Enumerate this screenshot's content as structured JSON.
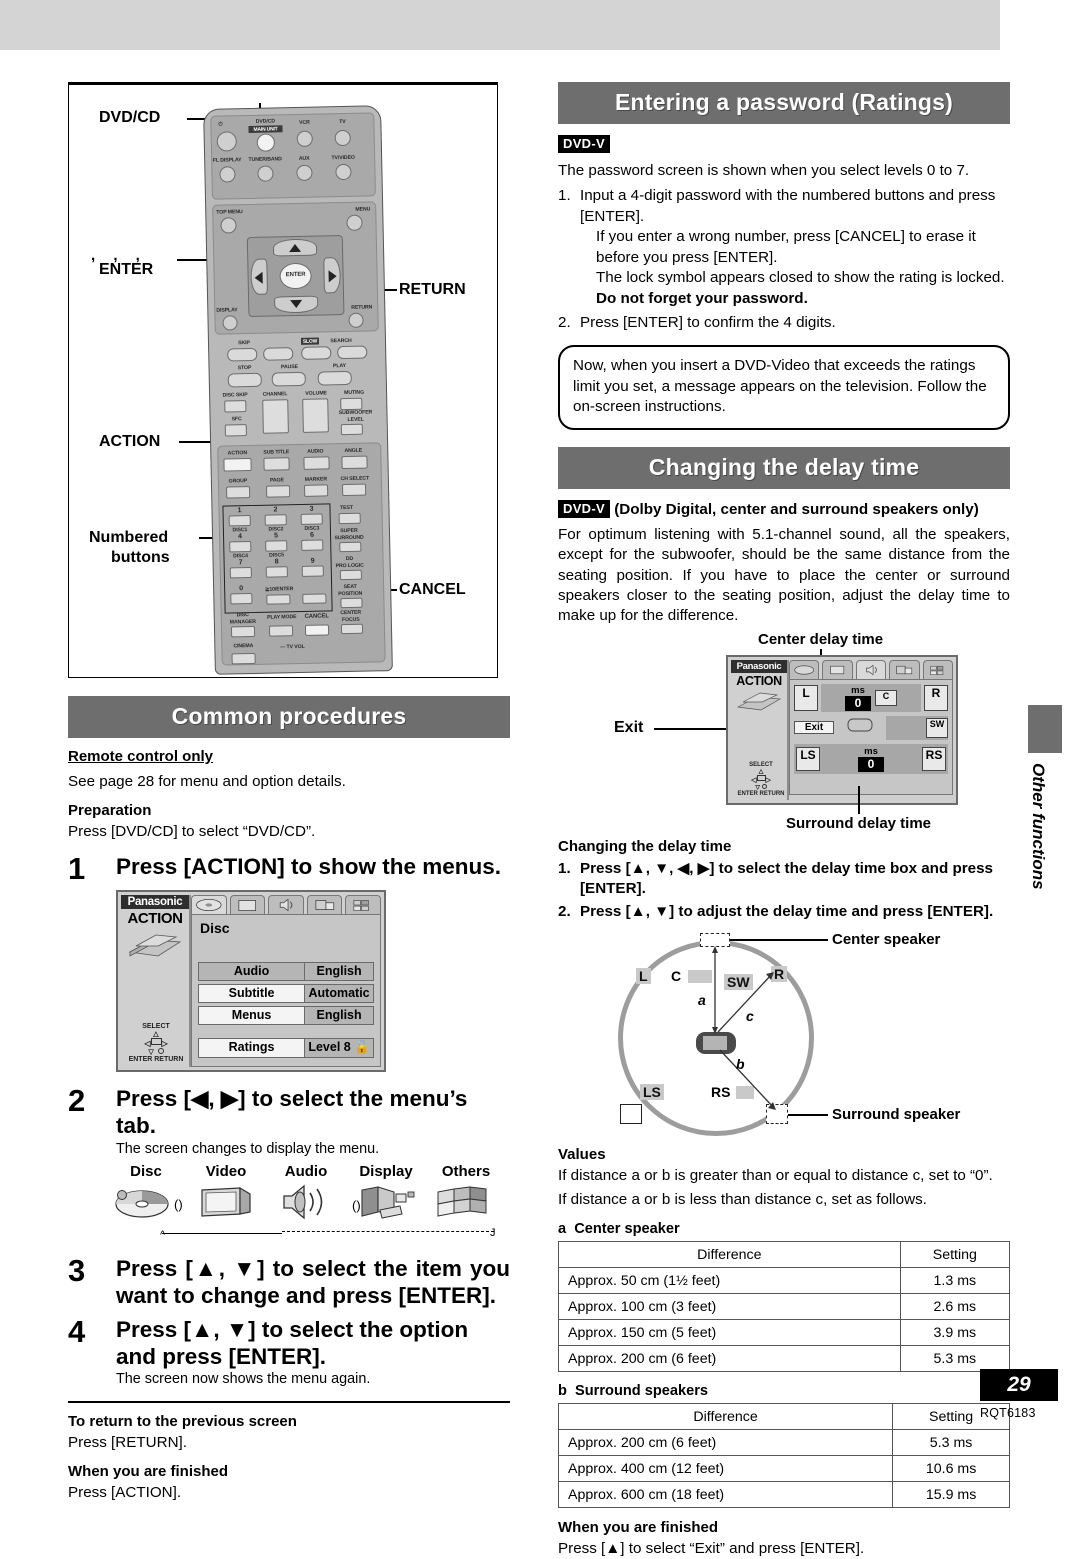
{
  "page": {
    "number": "29",
    "doc_code": "RQT6183"
  },
  "side_tab": {
    "label": "Other functions"
  },
  "remote_figure": {
    "callouts": {
      "dvd_cd": "DVD/CD",
      "arrows_enter": "ENTER",
      "return": "RETURN",
      "action": "ACTION",
      "numbered_buttons_l1": "Numbered",
      "numbered_buttons_l2": "buttons",
      "cancel": "CANCEL"
    },
    "buttons": {
      "power": "⏻",
      "dvd_cd": "DVD/CD",
      "main_unit": "MAIN UNIT",
      "vcr": "VCR",
      "tv": "TV",
      "fl_display": "FL DISPLAY",
      "tuner_band": "TUNER/BAND",
      "aux": "AUX",
      "tv_video": "TV/VIDEO",
      "top_menu": "TOP MENU",
      "menu": "MENU",
      "enter": "ENTER",
      "display": "DISPLAY",
      "return": "RETURN",
      "skip": "SKIP",
      "slow": "SLOW",
      "search": "SEARCH",
      "stop": "STOP",
      "pause": "PAUSE",
      "play": "PLAY",
      "disc_skip": "DISC SKIP",
      "channel": "CHANNEL",
      "volume": "VOLUME",
      "muting": "MUTING",
      "sfc": "SFC",
      "subwoofer": "SUBWOOFER",
      "level": "LEVEL",
      "action": "ACTION",
      "subtitle": "SUB TITLE",
      "audio": "AUDIO",
      "angle": "ANGLE",
      "group": "GROUP",
      "page": "PAGE",
      "marker": "MARKER",
      "ch_select": "CH SELECT",
      "test": "TEST",
      "super": "SUPER",
      "surround": "SURROUND",
      "dd": "DD",
      "pro_logic": "PRO LOGIC",
      "seat": "SEAT",
      "position": "POSITION",
      "n1": "1",
      "n2": "2",
      "n3": "3",
      "n4": "4",
      "n5": "5",
      "n6": "6",
      "n7": "7",
      "n8": "8",
      "n9": "9",
      "n0": "0",
      "disc1": "DISC1",
      "disc2": "DISC2",
      "disc3": "DISC3",
      "disc4": "DISC4",
      "disc5": "DISC5",
      "ten_enter": "≧10/ENTER",
      "disc_manager_l1": "DISC",
      "disc_manager_l2": "MANAGER",
      "play_mode": "PLAY MODE",
      "cancel": "CANCEL",
      "center_l1": "CENTER",
      "center_l2": "FOCUS",
      "cinema": "CINEMA",
      "tv_vol": "— TV VOL"
    }
  },
  "common_procedures": {
    "heading": "Common procedures",
    "remote_only": "Remote control only",
    "see_page": "See page 28 for menu and option details.",
    "preparation_label": "Preparation",
    "preparation_text": "Press [DVD/CD] to select “DVD/CD”.",
    "steps": [
      {
        "num": "1",
        "text": "Press [ACTION] to show the menus.",
        "sub": ""
      },
      {
        "num": "2",
        "text": "Press [◀, ▶] to select the menu’s tab.",
        "sub": "The screen changes to display the menu."
      },
      {
        "num": "3",
        "text": "Press [▲, ▼] to select the item you want to change and press [ENTER].",
        "sub": ""
      },
      {
        "num": "4",
        "text": "Press [▲, ▼] to select the option and press [ENTER].",
        "sub": "The screen now shows the menu again."
      }
    ],
    "tab_icons": [
      {
        "label": "Disc",
        "icon": "disc-icon"
      },
      {
        "label": "Video",
        "icon": "television-icon"
      },
      {
        "label": "Audio",
        "icon": "speaker-icon"
      },
      {
        "label": "Display",
        "icon": "display-panels-icon"
      },
      {
        "label": "Others",
        "icon": "grid-panels-icon"
      }
    ],
    "footer": [
      {
        "title": "To return to the previous screen",
        "body": "Press [RETURN]."
      },
      {
        "title": "When you are finished",
        "body": "Press [ACTION]."
      }
    ]
  },
  "disc_menu_osd": {
    "brand": "Panasonic",
    "action": "ACTION",
    "title": "Disc",
    "select_label": "SELECT",
    "enter_label": "ENTER",
    "return_label": "RETURN",
    "rows": [
      {
        "name": "Audio",
        "value": "English",
        "highlight": false
      },
      {
        "name": "Subtitle",
        "value": "Automatic",
        "highlight": true
      },
      {
        "name": "Menus",
        "value": "English",
        "highlight": true
      }
    ],
    "ratings_row": {
      "name": "Ratings",
      "value": "Level 8",
      "lock_icon": "lock-icon"
    }
  },
  "password_section": {
    "heading": "Entering a password (Ratings)",
    "chip": "DVD-V",
    "intro": "The password screen is shown when you select levels 0 to 7.",
    "steps": [
      {
        "num": "1.",
        "text": "Input a 4-digit password with the numbered buttons and press [ENTER].",
        "extra": [
          "If you enter a wrong number, press [CANCEL] to erase it before you press [ENTER].",
          "The lock symbol appears closed to show the rating is locked."
        ],
        "bold_note": "Do not forget your password."
      },
      {
        "num": "2.",
        "text": "Press [ENTER] to confirm the 4 digits.",
        "extra": [],
        "bold_note": ""
      }
    ],
    "callout": "Now, when you insert a DVD-Video that exceeds the ratings limit you set, a message appears on the television. Follow the on-screen instructions."
  },
  "delay_section": {
    "heading": "Changing the delay time",
    "chip": "DVD-V",
    "chip_suffix": "(Dolby Digital, center and surround speakers only)",
    "body": "For optimum listening with 5.1-channel sound, all the speakers, except for the subwoofer, should be the same distance from the seating position. If you have to place the center or surround speakers closer to the seating position, adjust the delay time to make up for the difference.",
    "osd": {
      "brand": "Panasonic",
      "action": "ACTION",
      "center_label": "Center delay time",
      "surround_label": "Surround delay time",
      "exit_callout": "Exit",
      "exit_button": "Exit",
      "center_unit": "ms",
      "center_value": "0",
      "surround_unit": "ms",
      "surround_value": "0",
      "speakers": {
        "l": "L",
        "c": "C",
        "r": "R",
        "sw": "SW",
        "ls": "LS",
        "rs": "RS"
      },
      "select_label": "SELECT",
      "enter_label": "ENTER",
      "return_label": "RETURN"
    },
    "procedure_title": "Changing the delay time",
    "procedure_steps": [
      {
        "num": "1.",
        "text": "Press [▲, ▼, ◀, ▶] to select the delay time box and press [ENTER]."
      },
      {
        "num": "2.",
        "text": "Press [▲, ▼] to adjust the delay time and press [ENTER]."
      }
    ],
    "diagram": {
      "center_speaker_label": "Center speaker",
      "surround_speaker_label": "Surround speaker",
      "speakers": {
        "l": "L",
        "c": "C",
        "sw": "SW",
        "r": "R",
        "ls": "LS",
        "rs": "RS"
      },
      "distances": {
        "a": "a",
        "b": "b",
        "c": "c"
      }
    },
    "values_title": "Values",
    "values_lines": [
      "If distance a or b is greater than or equal to distance c, set to “0”.",
      "If distance a or b is less than distance c, set as follows."
    ],
    "tables": [
      {
        "caption_key": "a",
        "caption": "Center speaker",
        "headers": [
          "Difference",
          "Setting"
        ],
        "rows": [
          [
            "Approx. 50 cm (1½ feet)",
            "1.3 ms"
          ],
          [
            "Approx. 100 cm (3 feet)",
            "2.6 ms"
          ],
          [
            "Approx. 150 cm (5 feet)",
            "3.9 ms"
          ],
          [
            "Approx. 200 cm (6 feet)",
            "5.3 ms"
          ]
        ]
      },
      {
        "caption_key": "b",
        "caption": "Surround speakers",
        "headers": [
          "Difference",
          "Setting"
        ],
        "rows": [
          [
            "Approx. 200 cm (6 feet)",
            "5.3 ms"
          ],
          [
            "Approx. 400 cm (12 feet)",
            "10.6 ms"
          ],
          [
            "Approx. 600 cm (18 feet)",
            "15.9 ms"
          ]
        ]
      }
    ],
    "finished_title": "When you are finished",
    "finished_body": "Press [▲] to select “Exit” and press [ENTER]."
  }
}
